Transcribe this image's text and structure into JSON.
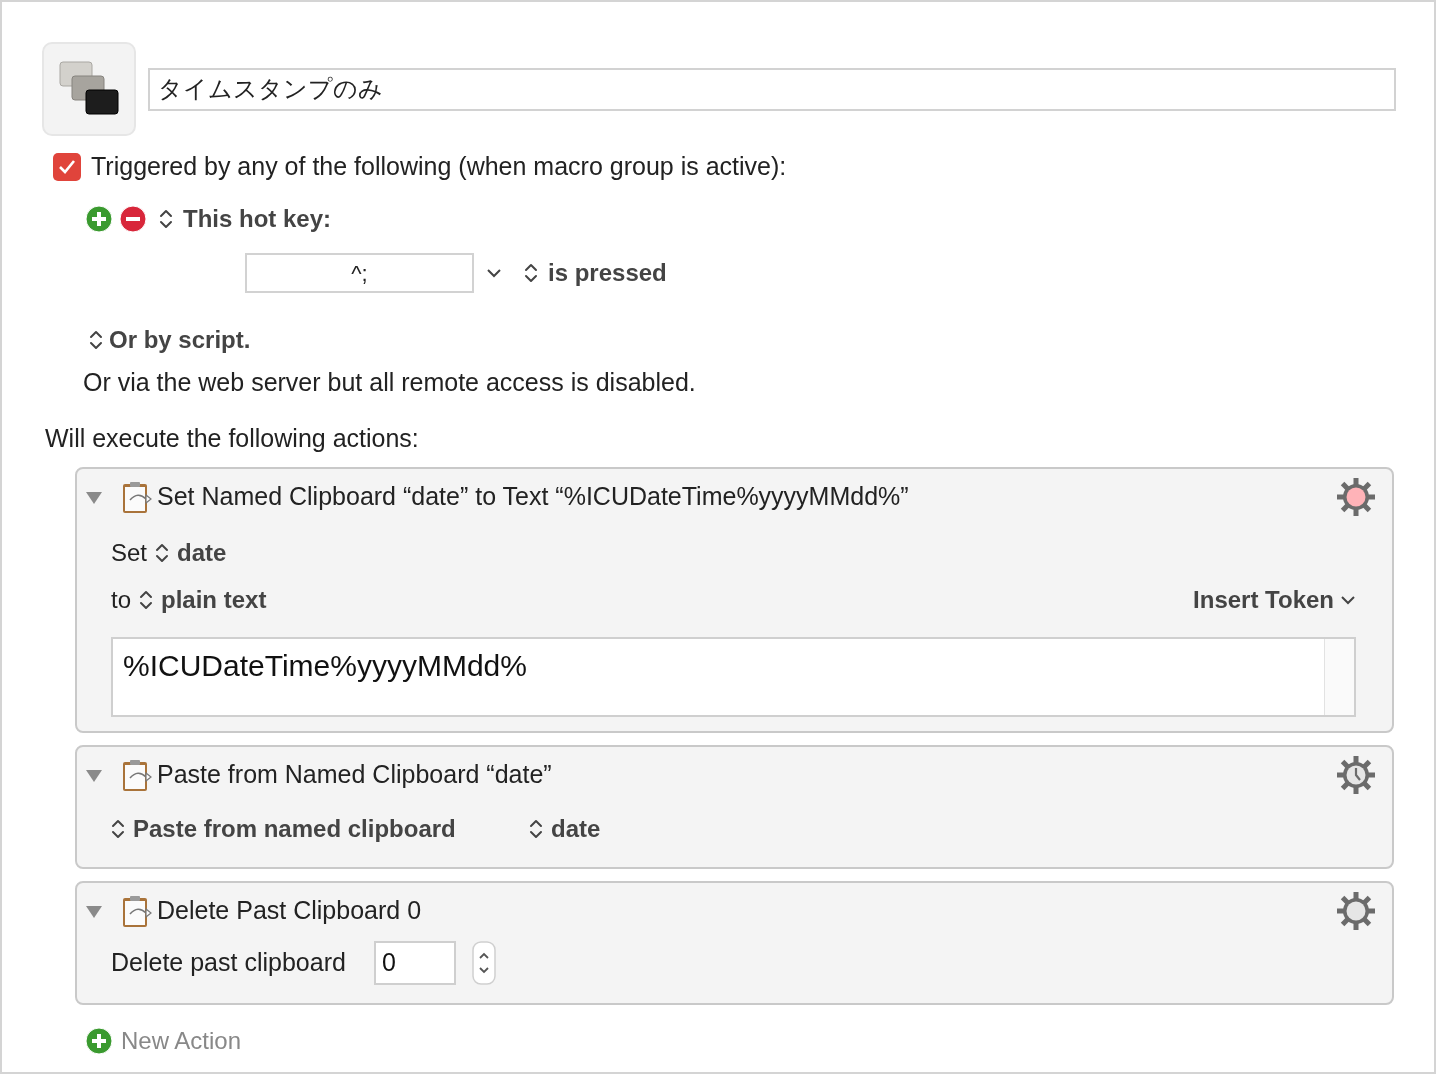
{
  "macro": {
    "name": "タイムスタンプのみ"
  },
  "trigger": {
    "enabled": true,
    "label": "Triggered by any of the following (when macro group is active):",
    "type_selector": "This hot key:",
    "hotkey": "^;",
    "condition": "is pressed"
  },
  "script_trigger": "Or by script.",
  "web_server_note": "Or via the web server but all remote access is disabled.",
  "actions_heading": "Will execute the following actions:",
  "actions": [
    {
      "kind": "set_clipboard",
      "title": "Set Named Clipboard “date” to Text “%ICUDateTime%yyyyMMdd%”",
      "expanded": true,
      "gear": {
        "kind": "highlight"
      },
      "set_label": "Set",
      "clipboard": "date",
      "to_label": "to",
      "text_type": "plain text",
      "insert_token": "Insert Token",
      "text": "%ICUDateTime%yyyyMMdd%"
    },
    {
      "kind": "paste",
      "title": "Paste from Named Clipboard “date”",
      "expanded": true,
      "gear": {
        "kind": "clock"
      },
      "mode": "Paste from named clipboard",
      "clipboard": "date"
    },
    {
      "kind": "delete",
      "title": "Delete Past Clipboard 0",
      "expanded": true,
      "gear": {
        "kind": "plain"
      },
      "label": "Delete past clipboard",
      "value": "0"
    }
  ],
  "new_action": "New Action"
}
